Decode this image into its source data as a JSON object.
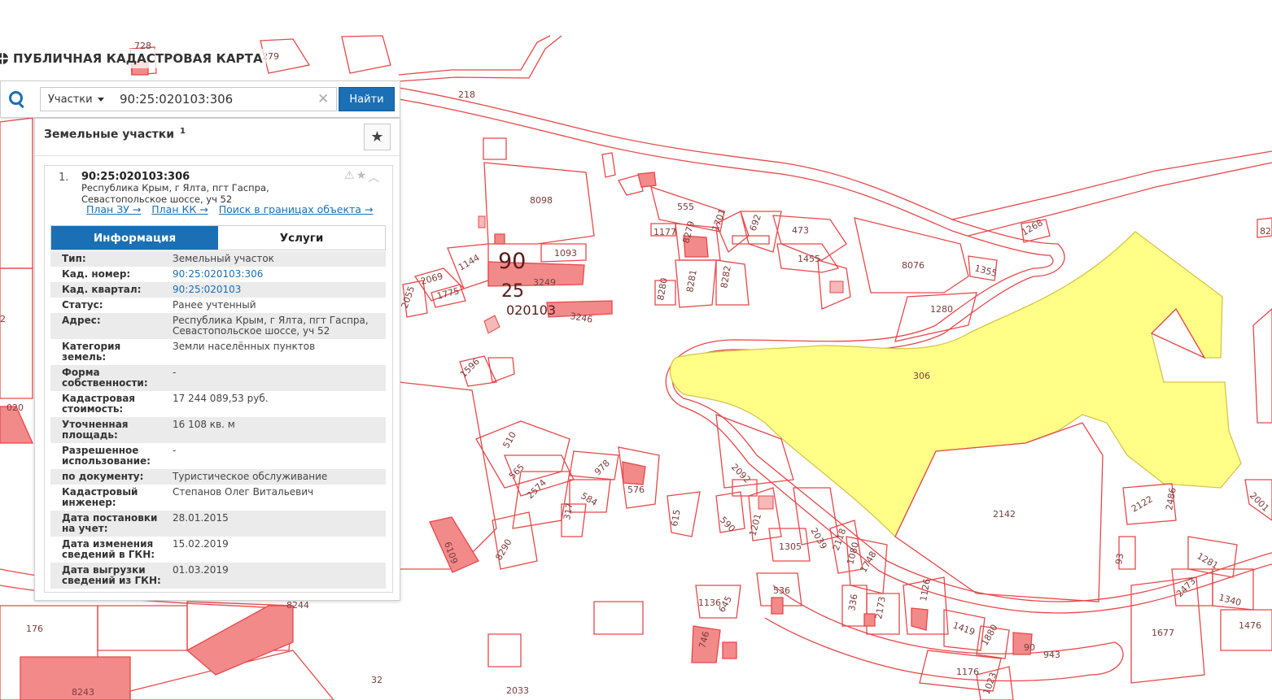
{
  "app": {
    "title": "ПУБЛИЧНАЯ КАДАСТРОВАЯ КАРТА"
  },
  "search": {
    "type_label": "Участки",
    "query": "90:25:020103:306",
    "clear": "✕",
    "find_label": "Найти"
  },
  "panel": {
    "title": "Земельные участки",
    "count": "1",
    "result": {
      "index": "1.",
      "cad_number": "90:25:020103:306",
      "address_line1": "Республика Крым, г Ялта, пгт Гаспра,",
      "address_line2": "Севастопольское шоссе, уч 52",
      "links": [
        "План ЗУ →",
        "План КК →",
        "Поиск в границах объекта →"
      ],
      "tabs": [
        "Информация",
        "Услуги"
      ],
      "info": [
        {
          "key": "Тип:",
          "value": "Земельный участок"
        },
        {
          "key": "Кад. номер:",
          "value": "90:25:020103:306",
          "link": true
        },
        {
          "key": "Кад. квартал:",
          "value": "90:25:020103",
          "link": true
        },
        {
          "key": "Статус:",
          "value": "Ранее учтенный"
        },
        {
          "key": "Адрес:",
          "value": "Республика Крым, г Ялта, пгт Гаспра, Севастопольское шоссе, уч 52"
        },
        {
          "key": "Категория земель:",
          "value": "Земли населённых пунктов"
        },
        {
          "key": "Форма собственности:",
          "value": "-"
        },
        {
          "key": "Кадастровая стоимость:",
          "value": "17 244 089,53 руб."
        },
        {
          "key": "Уточненная площадь:",
          "value": "16 108 кв. м"
        },
        {
          "key": "Разрешенное использование:",
          "value": "-"
        },
        {
          "key": "по документу:",
          "value": "Туристическое обслуживание"
        },
        {
          "key": "Кадастровый инженер:",
          "value": "Степанов Олег Витальевич"
        },
        {
          "key": "Дата постановки на учет:",
          "value": "28.01.2015"
        },
        {
          "key": "Дата изменения сведений в ГКН:",
          "value": "15.02.2019"
        },
        {
          "key": "Дата выгрузки сведений из ГКН:",
          "value": "01.03.2019"
        }
      ]
    }
  },
  "map": {
    "selected_parcel": "306",
    "quarter_labels": [
      "90",
      "25",
      "020103"
    ],
    "parcel_labels": [
      "728",
      "279",
      "218",
      "8098",
      "555",
      "1177",
      "8279",
      "1701",
      "692",
      "473",
      "1455",
      "8076",
      "1355",
      "1268",
      "82",
      "1093",
      "1144",
      "2069",
      "2055",
      "1775",
      "3249",
      "3246",
      "8280",
      "8281",
      "8282",
      "1280",
      "1596",
      "510",
      "565",
      "978",
      "576",
      "2574",
      "584",
      "317",
      "615",
      "8290",
      "2092",
      "590",
      "1201",
      "2039",
      "1305",
      "2118",
      "1080",
      "1748",
      "2142",
      "2122",
      "2486",
      "2001",
      "93",
      "1281",
      "2473",
      "1340",
      "1476",
      "1677",
      "536",
      "1136",
      "645",
      "336",
      "2173",
      "1126",
      "1419",
      "1880",
      "943",
      "90",
      "1176",
      "1023",
      "2",
      "176",
      "8244",
      "8243",
      "32",
      "746",
      "6109",
      "020",
      "2033"
    ],
    "colors": {
      "parcel_line": "#e8474a",
      "parcel_fill": "#f28a8a",
      "selected_fill": "#ffff88",
      "accent": "#1a6fb5"
    }
  }
}
